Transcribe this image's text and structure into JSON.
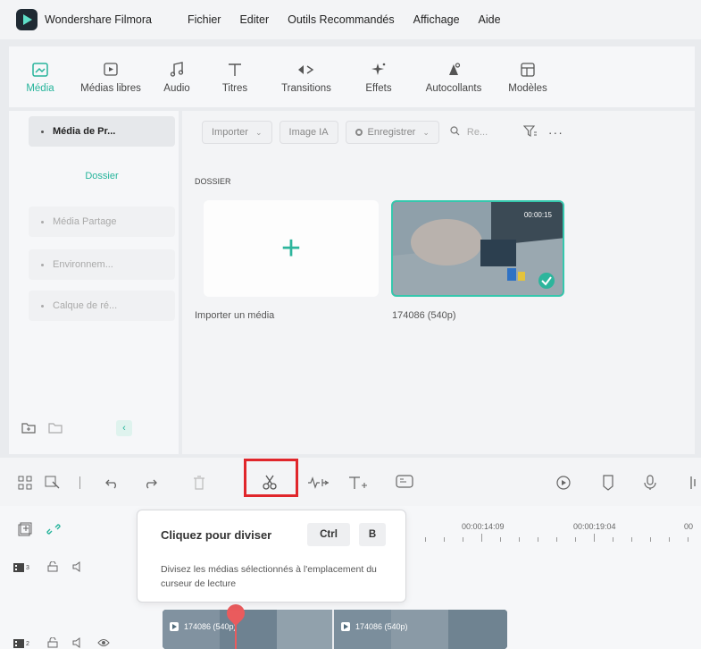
{
  "app": {
    "title": "Wondershare Filmora"
  },
  "menu": [
    "Fichier",
    "Editer",
    "Outils Recommandés",
    "Affichage",
    "Aide"
  ],
  "toolbar": [
    {
      "label": "Média",
      "icon": "media-icon",
      "active": true
    },
    {
      "label": "Médias libres",
      "icon": "stock-media-icon"
    },
    {
      "label": "Audio",
      "icon": "music-note-icon"
    },
    {
      "label": "Titres",
      "icon": "text-t-icon"
    },
    {
      "label": "Transitions",
      "icon": "transition-arrows-icon"
    },
    {
      "label": "Effets",
      "icon": "effects-sparkle-icon"
    },
    {
      "label": "Autocollants",
      "icon": "sticker-icon"
    },
    {
      "label": "Modèles",
      "icon": "template-icon"
    }
  ],
  "sidebar": {
    "items": [
      {
        "label": "Média de Pr...",
        "selected": true
      },
      {
        "label": "Dossier"
      },
      {
        "label": "Média Partage"
      },
      {
        "label": "Environnem..."
      },
      {
        "label": "Calque de ré..."
      }
    ]
  },
  "filters": {
    "import": "Importer",
    "ai_image": "Image IA",
    "record": "Enregistrer",
    "search_placeholder": "Re..."
  },
  "library": {
    "section": "DOSSIER",
    "import_caption": "Importer un média",
    "clip_caption": "174086 (540p)",
    "clip_duration": "00:00:15"
  },
  "timeline": {
    "timecodes": [
      "00:00:14:09",
      "00:00:19:04",
      "00"
    ],
    "track_labels": [
      "3",
      "2"
    ],
    "clip_names": [
      "174086 (540p)",
      "174086 (540p)"
    ]
  },
  "tooltip": {
    "title": "Cliquez pour diviser",
    "key1": "Ctrl",
    "key2": "B",
    "description": "Divisez les médias sélectionnés à l'emplacement du curseur de lecture"
  },
  "colors": {
    "accent": "#26b49b",
    "highlight": "#e0262b",
    "playhead": "#ea5b5d"
  }
}
